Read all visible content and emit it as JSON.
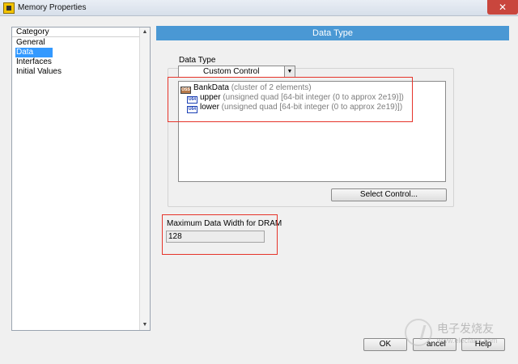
{
  "window": {
    "title": "Memory Properties",
    "close_glyph": "✕"
  },
  "category": {
    "header": "Category",
    "items": [
      {
        "label": "General",
        "selected": false
      },
      {
        "label": "Data Type",
        "selected": true
      },
      {
        "label": "Interfaces",
        "selected": false
      },
      {
        "label": "Initial Values",
        "selected": false
      }
    ],
    "scroll_up_glyph": "▲",
    "scroll_down_glyph": "▼"
  },
  "panel": {
    "banner": "Data Type",
    "data_type_label": "Data Type",
    "dropdown_value": "Custom Control",
    "dropdown_glyph": "▼",
    "tree": [
      {
        "icon": "cluster-icon",
        "icon_text": "OSS",
        "name": "BankData",
        "desc": " (cluster of 2 elements)"
      },
      {
        "icon": "u64-icon",
        "icon_text": "U64",
        "name": "upper",
        "desc": " (unsigned quad [64-bit integer (0 to approx 2e19)])"
      },
      {
        "icon": "u64-icon",
        "icon_text": "U64",
        "name": "lower",
        "desc": " (unsigned quad [64-bit integer (0 to approx 2e19)])"
      }
    ],
    "select_control_label": "Select Control...",
    "max_width_label": "Maximum Data Width for DRAM",
    "max_width_value": "128"
  },
  "footer": {
    "ok_label": "OK",
    "cancel_label": "ancel",
    "help_label": "Help"
  },
  "watermark": {
    "text": "电子发烧友",
    "url": "www.elecfans.com"
  },
  "colors": {
    "banner": "#4a98d4",
    "selection": "#3399ff",
    "highlight_box": "#e6342a"
  }
}
